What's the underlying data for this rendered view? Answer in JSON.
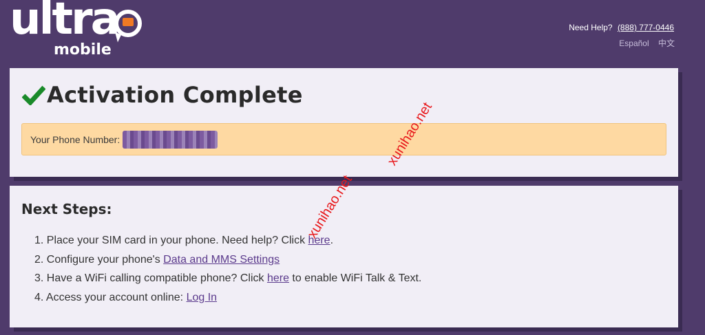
{
  "brand": {
    "logo_main": "ultra",
    "logo_sub": "mobile",
    "colors": {
      "background": "#4f3b6b",
      "panel": "#f1eef6",
      "accent_orange": "#f07a24",
      "check_green": "#1a8a2a",
      "link_purple": "#5b3a8c",
      "alert_bg": "#fed9a2"
    }
  },
  "header": {
    "help_label": "Need Help?",
    "help_phone": "(888) 777-0446",
    "languages": [
      "Español",
      "中文"
    ]
  },
  "activation": {
    "icon": "check-icon",
    "title": "Activation Complete",
    "phone_label": "Your Phone Number:",
    "phone_value": ""
  },
  "next_steps": {
    "title": "Next Steps:",
    "items": [
      {
        "number": "1.",
        "text_before": "Place your SIM card in your phone. Need help? Click ",
        "link": "here",
        "text_after": "."
      },
      {
        "number": "2.",
        "text_before": "Configure your phone's ",
        "link": "Data and MMS Settings",
        "text_after": ""
      },
      {
        "number": "3.",
        "text_before": "Have a WiFi calling compatible phone? Click ",
        "link": "here",
        "text_after": " to enable WiFi Talk & Text."
      },
      {
        "number": "4.",
        "text_before": "Access your account online: ",
        "link": "Log In",
        "text_after": ""
      }
    ]
  },
  "watermarks": [
    "xunihao.net",
    "xunihao.net"
  ]
}
